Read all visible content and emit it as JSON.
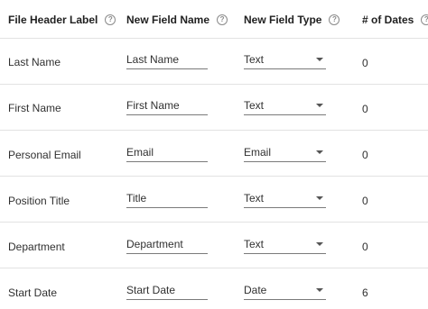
{
  "headers": {
    "file_header_label": "File Header Label",
    "new_field_name": "New Field Name",
    "new_field_type": "New Field Type",
    "num_dates": "# of Dates",
    "help_glyph": "?"
  },
  "rows": [
    {
      "label": "Last Name",
      "field_name": "Last Name",
      "field_type": "Text",
      "dates": "0"
    },
    {
      "label": "First Name",
      "field_name": "First Name",
      "field_type": "Text",
      "dates": "0"
    },
    {
      "label": "Personal Email",
      "field_name": "Email",
      "field_type": "Email",
      "dates": "0"
    },
    {
      "label": "Position Title",
      "field_name": "Title",
      "field_type": "Text",
      "dates": "0"
    },
    {
      "label": "Department",
      "field_name": "Department",
      "field_type": "Text",
      "dates": "0"
    },
    {
      "label": "Start Date",
      "field_name": "Start Date",
      "field_type": "Date",
      "dates": "6"
    }
  ],
  "icons": {
    "help": "help-circle-icon",
    "dropdown": "caret-down-icon"
  }
}
